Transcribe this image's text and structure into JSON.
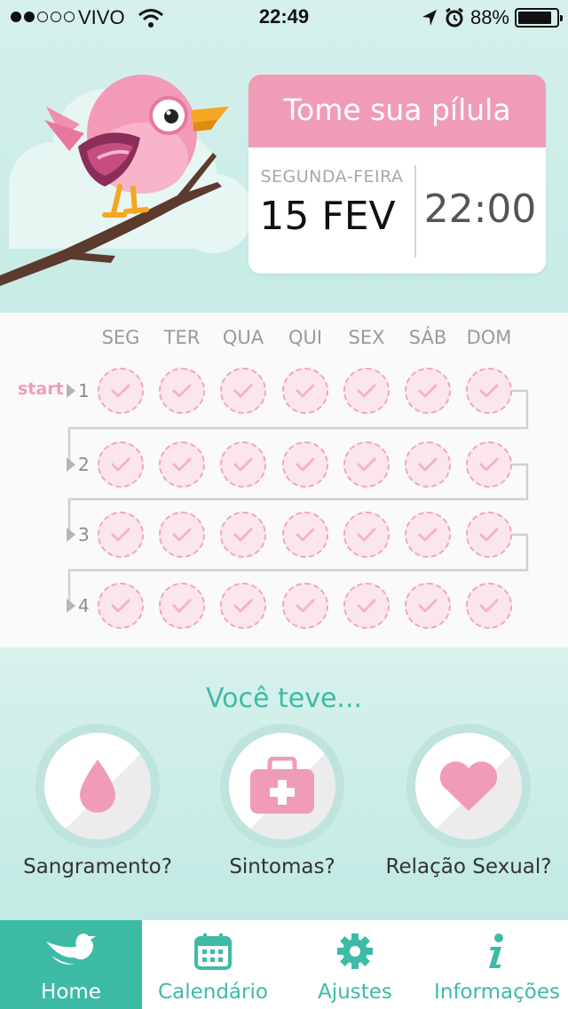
{
  "status_bar": {
    "carrier": "VIVO",
    "time": "22:49",
    "battery": "88%",
    "battery_level": 0.88,
    "signal_strength": 2,
    "signal_total": 5
  },
  "pill_card": {
    "title": "Tome sua pílula",
    "weekday": "SEGUNDA-FEIRA",
    "date": "15 FEV",
    "time": "22:00"
  },
  "pack": {
    "start_label": "start",
    "days": [
      "SEG",
      "TER",
      "QUA",
      "QUI",
      "SEX",
      "SÁB",
      "DOM"
    ],
    "weeks": [
      "1",
      "2",
      "3",
      "4"
    ],
    "pill_icon": "check-icon"
  },
  "events": {
    "title": "Você teve...",
    "items": [
      {
        "label": "Sangramento?",
        "icon": "drop-icon"
      },
      {
        "label": "Sintomas?",
        "icon": "medkit-icon"
      },
      {
        "label": "Relação Sexual?",
        "icon": "heart-icon"
      }
    ]
  },
  "tabbar": {
    "items": [
      {
        "label": "Home",
        "icon": "bird-icon",
        "active": true
      },
      {
        "label": "Calendário",
        "icon": "calendar-icon",
        "active": false
      },
      {
        "label": "Ajustes",
        "icon": "gear-icon",
        "active": false
      },
      {
        "label": "Informações",
        "icon": "info-icon",
        "active": false
      }
    ]
  },
  "colors": {
    "pink": "#f09cb7",
    "teal": "#3dbba5",
    "mint_bg": "#d6f0ec"
  }
}
